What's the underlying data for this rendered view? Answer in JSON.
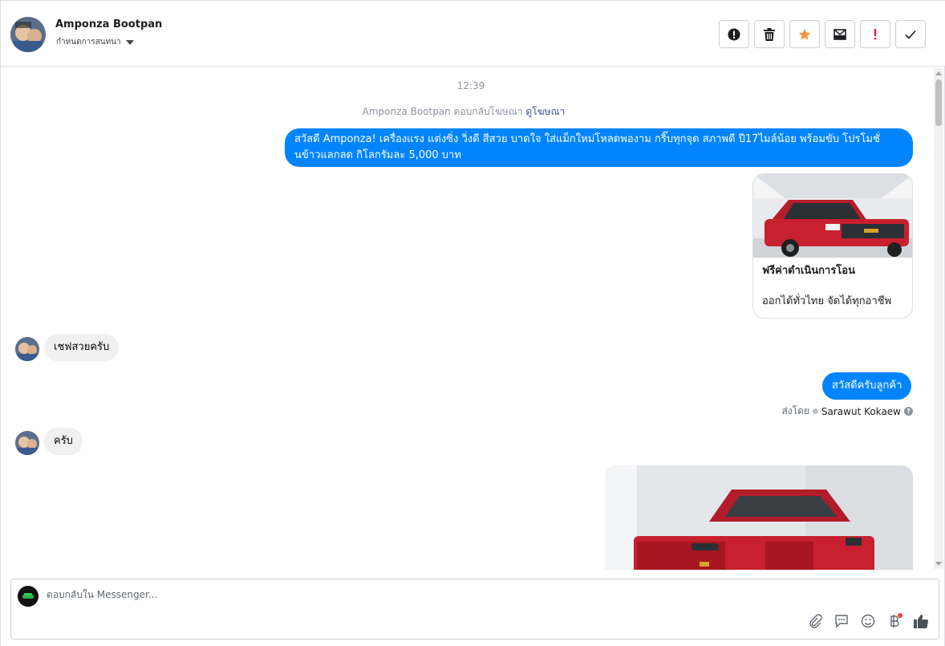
{
  "header": {
    "contact_name": "Amponza Bootpan",
    "status_label": "กำหนดการสนทนา",
    "actions": [
      {
        "name": "report-spam-button",
        "icon": "exclamation-circle-icon"
      },
      {
        "name": "delete-button",
        "icon": "trash-icon"
      },
      {
        "name": "star-button",
        "icon": "star-icon"
      },
      {
        "name": "mark-unread-button",
        "icon": "envelope-icon"
      },
      {
        "name": "important-button",
        "icon": "exclamation-icon"
      },
      {
        "name": "mark-done-button",
        "icon": "check-icon"
      }
    ]
  },
  "conversation": {
    "timestamp": "12:39",
    "reply_note": "Amponza Bootpan ตอบกลับโฆษณา",
    "reply_link": "ดูโฆษณา",
    "messages": [
      {
        "direction": "out",
        "text": "สวัสดี Amponza! เครื่องแรง แต่งซิ่ง วิ่งดี สีสวย บาดใจ ใส่แม็กใหม่โหลดพองาม กริ๊บทุกจุด สภาพดี ปี17ไมล์น้อย พร้อมขับ โปรโมชั่นข้าวแลกลด กิโลกรัมละ 5,000 บาท"
      },
      {
        "direction": "in",
        "text": "เชฟสวยครับ"
      },
      {
        "direction": "out",
        "text": "สวัสดีครับลูกค้า"
      },
      {
        "direction": "in",
        "text": "ครับ"
      }
    ],
    "ad_card": {
      "title": "ฟรีค่าดำเนินการโอน",
      "subtitle": "ออกได้ทั่วไทย จัดได้ทุกอาชีพ"
    },
    "sent_by_label": "ส่งโดย",
    "sent_by_name": "Sarawut Kokaew"
  },
  "composer": {
    "placeholder": "ตอบกลับใน Messenger...",
    "value": "",
    "tools": [
      "paperclip-icon",
      "chat-icon",
      "smiley-icon",
      "baht-icon",
      "thumbs-up-icon"
    ]
  },
  "colors": {
    "accent": "#0084ff",
    "incoming_bubble": "#f0f0f0",
    "star": "#f7923b",
    "important": "#e41e3f",
    "car_red": "#c8202e"
  }
}
